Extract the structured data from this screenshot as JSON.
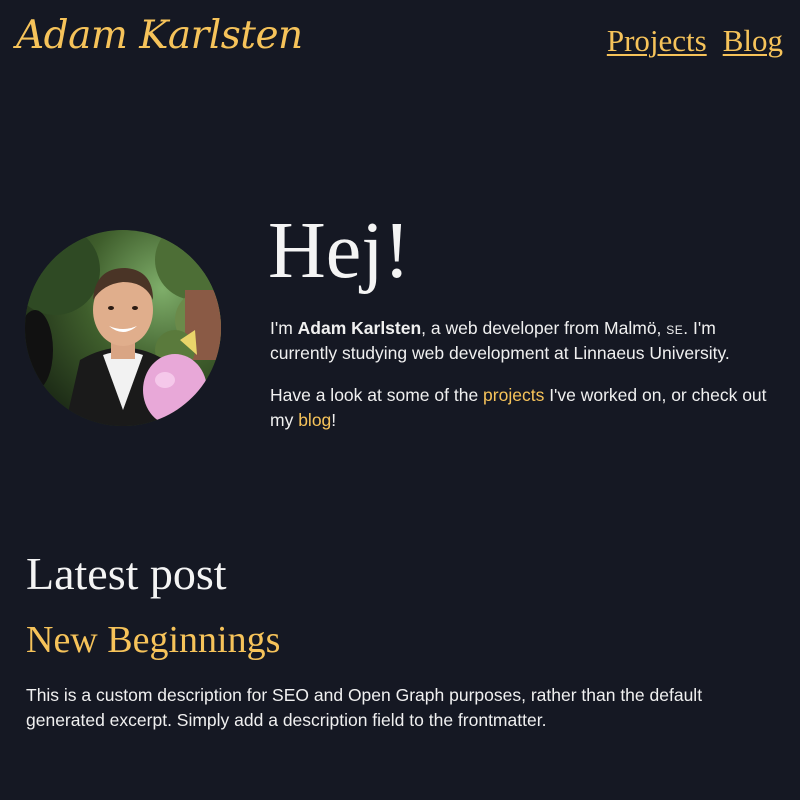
{
  "header": {
    "site_title": "Adam Karlsten",
    "nav": [
      {
        "label": "Projects"
      },
      {
        "label": "Blog"
      }
    ]
  },
  "hero": {
    "greeting": "Hej!",
    "intro_line1": {
      "prefix": "I'm ",
      "name": "Adam Karlsten",
      "middle": ", a web developer from Malmö, ",
      "country": "SE",
      "suffix": ". I'm currently studying web development at Linnaeus University."
    },
    "intro_line2": {
      "prefix": "Have a look at some of the ",
      "projects_link": "projects",
      "middle": " I've worked on, or check out my ",
      "blog_link": "blog",
      "suffix": "!"
    }
  },
  "latest": {
    "heading": "Latest post",
    "post_title": "New Beginnings",
    "post_description": "This is a custom description for SEO and Open Graph purposes, rather than the default generated excerpt. Simply add a description field to the frontmatter."
  },
  "colors": {
    "background": "#151823",
    "accent": "#f6c35a",
    "text": "#f2f2f2"
  },
  "icons": {
    "avatar": "profile-photo"
  }
}
